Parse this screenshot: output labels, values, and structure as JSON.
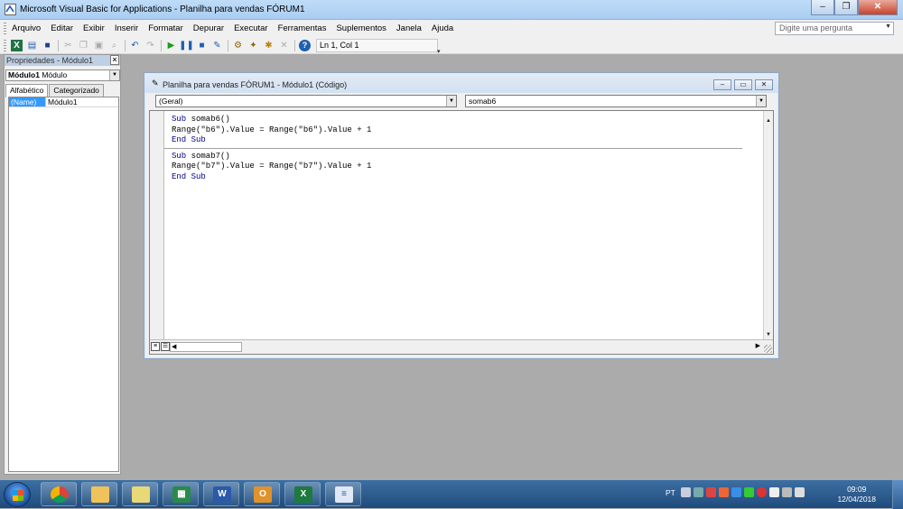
{
  "window": {
    "title": "Microsoft Visual Basic for Applications - Planilha para vendas  FÓRUM1",
    "buttons": {
      "minimize": "–",
      "restore": "❐",
      "close": "✕"
    }
  },
  "menu": {
    "items": [
      "Arquivo",
      "Editar",
      "Exibir",
      "Inserir",
      "Formatar",
      "Depurar",
      "Executar",
      "Ferramentas",
      "Suplementos",
      "Janela",
      "Ajuda"
    ]
  },
  "help_search": {
    "placeholder": "Digite uma pergunta"
  },
  "toolbar": {
    "position": "Ln 1, Col 1"
  },
  "properties": {
    "title": "Propriedades - Módulo1",
    "close": "×",
    "object_name": "Módulo1",
    "object_type": "Módulo",
    "tabs": [
      "Alfabético",
      "Categorizado"
    ],
    "rows": [
      {
        "key": "(Name)",
        "value": "Módulo1"
      }
    ]
  },
  "code_window": {
    "title": "Planilha para vendas  FÓRUM1 - Módulo1 (Código)",
    "object_combo": "(Geral)",
    "procedure_combo": "somab6",
    "procedures": [
      {
        "line1": "Sub somab6()",
        "line2": "Range(\"b6\").Value = Range(\"b6\").Value + 1",
        "line3": "End Sub"
      },
      {
        "line1": "Sub somab7()",
        "line2": "Range(\"b7\").Value = Range(\"b7\").Value + 1",
        "line3": "End Sub"
      }
    ]
  },
  "taskbar": {
    "apps": [
      "chrome",
      "file-explorer",
      "folder",
      "excel-doc",
      "word",
      "outlook",
      "excel",
      "notepad"
    ],
    "language": "PT",
    "time": "09:09",
    "date": "12/04/2018"
  }
}
